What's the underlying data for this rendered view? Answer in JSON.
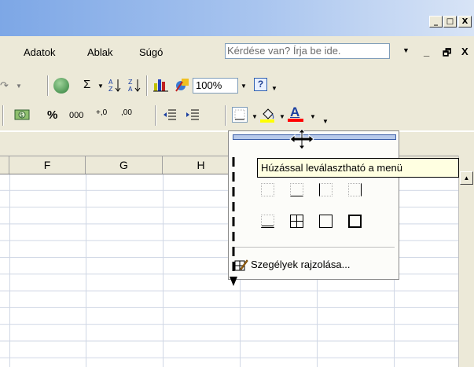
{
  "window": {
    "minimize_glyph": "_",
    "maximize_glyph": "□",
    "close_glyph": "X"
  },
  "menu": {
    "items": [
      "Adatok",
      "Ablak",
      "Súgó"
    ],
    "help_placeholder": "Kérdése van? Írja be ide.",
    "doc_min": "_",
    "doc_restore": "🗗",
    "doc_close": "X"
  },
  "standard_toolbar": {
    "sigma": "Σ",
    "zoom": "100%"
  },
  "format_toolbar": {
    "percent": "%",
    "thousands": "000",
    "inc_decimal": "+,0",
    "dec_decimal": ",00",
    "font_color_letter": "A"
  },
  "columns": [
    "F",
    "G",
    "H"
  ],
  "border_popup": {
    "tooltip": "Húzással leválasztható a menü",
    "draw_borders": "Szegélyek rajzolása..."
  },
  "colors": {
    "fill_yellow": "#ffff00",
    "font_red": "#ff0000",
    "title_blue": "#7da7e6"
  }
}
